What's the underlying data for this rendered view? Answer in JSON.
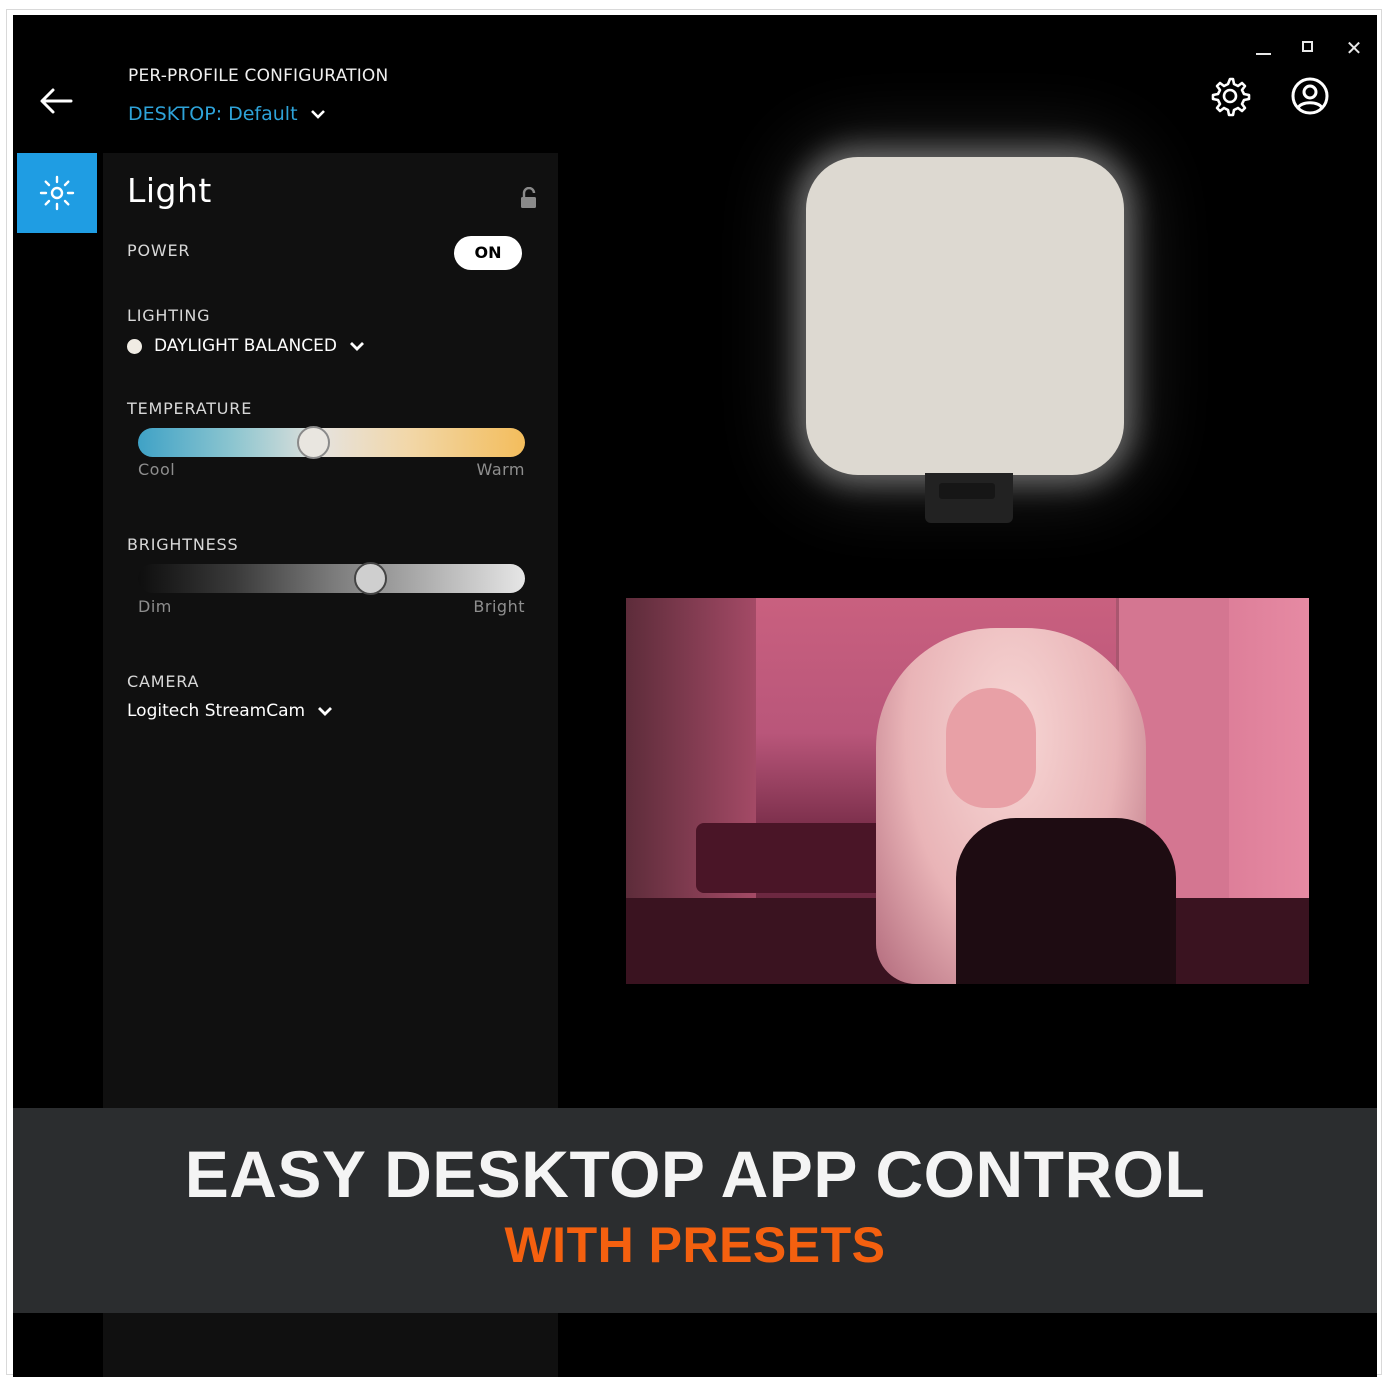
{
  "header": {
    "title": "PER-PROFILE CONFIGURATION",
    "profile_prefix": "DESKTOP:",
    "profile_name": "Default"
  },
  "window_controls": {
    "minimize_icon": "minimize-icon",
    "maximize_icon": "maximize-icon",
    "close_glyph": "✕"
  },
  "toolbar": {
    "settings_icon": "gear-icon",
    "account_icon": "user-icon",
    "back_icon": "back-arrow-icon"
  },
  "sidebar": {
    "items": [
      {
        "icon": "light-icon",
        "active": true
      }
    ]
  },
  "panel": {
    "title": "Light",
    "power": {
      "label": "POWER",
      "state": "ON"
    },
    "lighting": {
      "label": "LIGHTING",
      "value": "DAYLIGHT BALANCED"
    },
    "temperature": {
      "label": "TEMPERATURE",
      "min_label": "Cool",
      "max_label": "Warm",
      "value": 0.45
    },
    "brightness": {
      "label": "BRIGHTNESS",
      "min_label": "Dim",
      "max_label": "Bright",
      "value": 0.61
    },
    "camera": {
      "label": "CAMERA",
      "value": "Logitech StreamCam"
    }
  },
  "banner": {
    "headline": "EASY DESKTOP APP CONTROL",
    "subheadline": "WITH PRESETS"
  },
  "colors": {
    "accent": "#1f9de3",
    "profile_link": "#2ea3d9",
    "banner_sub": "#f4600f",
    "banner_bg": "#2b2d2f"
  }
}
